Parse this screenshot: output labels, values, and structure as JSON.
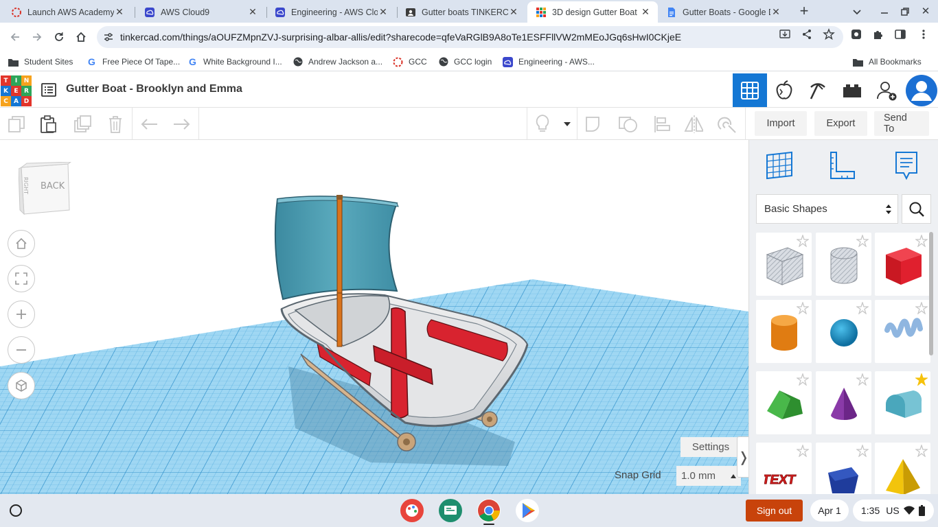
{
  "browser": {
    "tabs": [
      {
        "title": "Launch AWS Academy",
        "icon": "aws-academy-icon",
        "active": false
      },
      {
        "title": "AWS Cloud9",
        "icon": "cloud9-icon",
        "active": false
      },
      {
        "title": "Engineering - AWS Clo",
        "icon": "cloud9-icon",
        "active": false
      },
      {
        "title": "Gutter boats TINKERCA",
        "icon": "tinkercad-shared-icon",
        "active": false
      },
      {
        "title": "3D design Gutter Boat",
        "icon": "tinkercad-icon",
        "active": true
      },
      {
        "title": "Gutter Boats - Google D",
        "icon": "google-docs-icon",
        "active": false
      }
    ],
    "url": "tinkercad.com/things/aOUFZMpnZVJ-surprising-albar-allis/edit?sharecode=qfeVaRGlB9A8oTe1ESFFllVW2mMEoJGq6sHwI0CKjeE",
    "bookmarks": [
      {
        "label": "Student Sites",
        "icon": "folder-icon"
      },
      {
        "label": "Free Piece Of Tape...",
        "icon": "google-icon"
      },
      {
        "label": "White Background I...",
        "icon": "google-icon"
      },
      {
        "label": "Andrew Jackson a...",
        "icon": "globe-icon"
      },
      {
        "label": "GCC",
        "icon": "gcc-icon"
      },
      {
        "label": "GCC login",
        "icon": "globe-icon"
      },
      {
        "label": "Engineering - AWS...",
        "icon": "cloud9-icon"
      }
    ],
    "all_bookmarks": "All Bookmarks"
  },
  "app": {
    "logo_letters": [
      "T",
      "I",
      "N",
      "K",
      "E",
      "R",
      "C",
      "A",
      "D"
    ],
    "design_title": "Gutter Boat - Brooklyn and Emma",
    "toolbar": {
      "import_label": "Import",
      "export_label": "Export",
      "send_to_label": "Send To"
    },
    "viewcube_label": "BACK",
    "viewcube_side": "RIGHT",
    "settings_label": "Settings",
    "snap_grid_label": "Snap Grid",
    "snap_grid_value": "1.0 mm",
    "panel_toggle_glyph": "❭"
  },
  "shapes_panel": {
    "category": "Basic Shapes",
    "shapes": [
      {
        "name": "Box (hole)",
        "icon": "box-hole-icon",
        "favorite": false
      },
      {
        "name": "Cylinder (hole)",
        "icon": "cylinder-hole-icon",
        "favorite": false
      },
      {
        "name": "Box",
        "icon": "box-icon",
        "color": "#e0202e",
        "favorite": false
      },
      {
        "name": "Cylinder",
        "icon": "cylinder-icon",
        "color": "#f08a1c",
        "favorite": false
      },
      {
        "name": "Sphere",
        "icon": "sphere-icon",
        "color": "#1793c8",
        "favorite": false
      },
      {
        "name": "Scribble",
        "icon": "scribble-icon",
        "color": "#8fb6e0",
        "favorite": false
      },
      {
        "name": "Roof",
        "icon": "roof-icon",
        "color": "#3aa43a",
        "favorite": false
      },
      {
        "name": "Cone",
        "icon": "cone-icon",
        "color": "#8a3aa8",
        "favorite": false
      },
      {
        "name": "Round Roof",
        "icon": "round-roof-icon",
        "color": "#5fb8cc",
        "favorite": true
      },
      {
        "name": "Text",
        "icon": "text-shape-icon",
        "color": "#e02020",
        "favorite": false
      },
      {
        "name": "Polygon",
        "icon": "polygon-icon",
        "color": "#1f3c9c",
        "favorite": false
      },
      {
        "name": "Pyramid",
        "icon": "pyramid-icon",
        "color": "#f2c40c",
        "favorite": false
      }
    ],
    "text_shape_label": "TEXT"
  },
  "shelf": {
    "sign_out_label": "Sign out",
    "date": "Apr 1",
    "time": "1:35",
    "locale": "US"
  },
  "colors": {
    "tinkercad_blue": "#1477d4",
    "grid_blue": "#7ec8ee",
    "sign_out": "#c8430b"
  }
}
